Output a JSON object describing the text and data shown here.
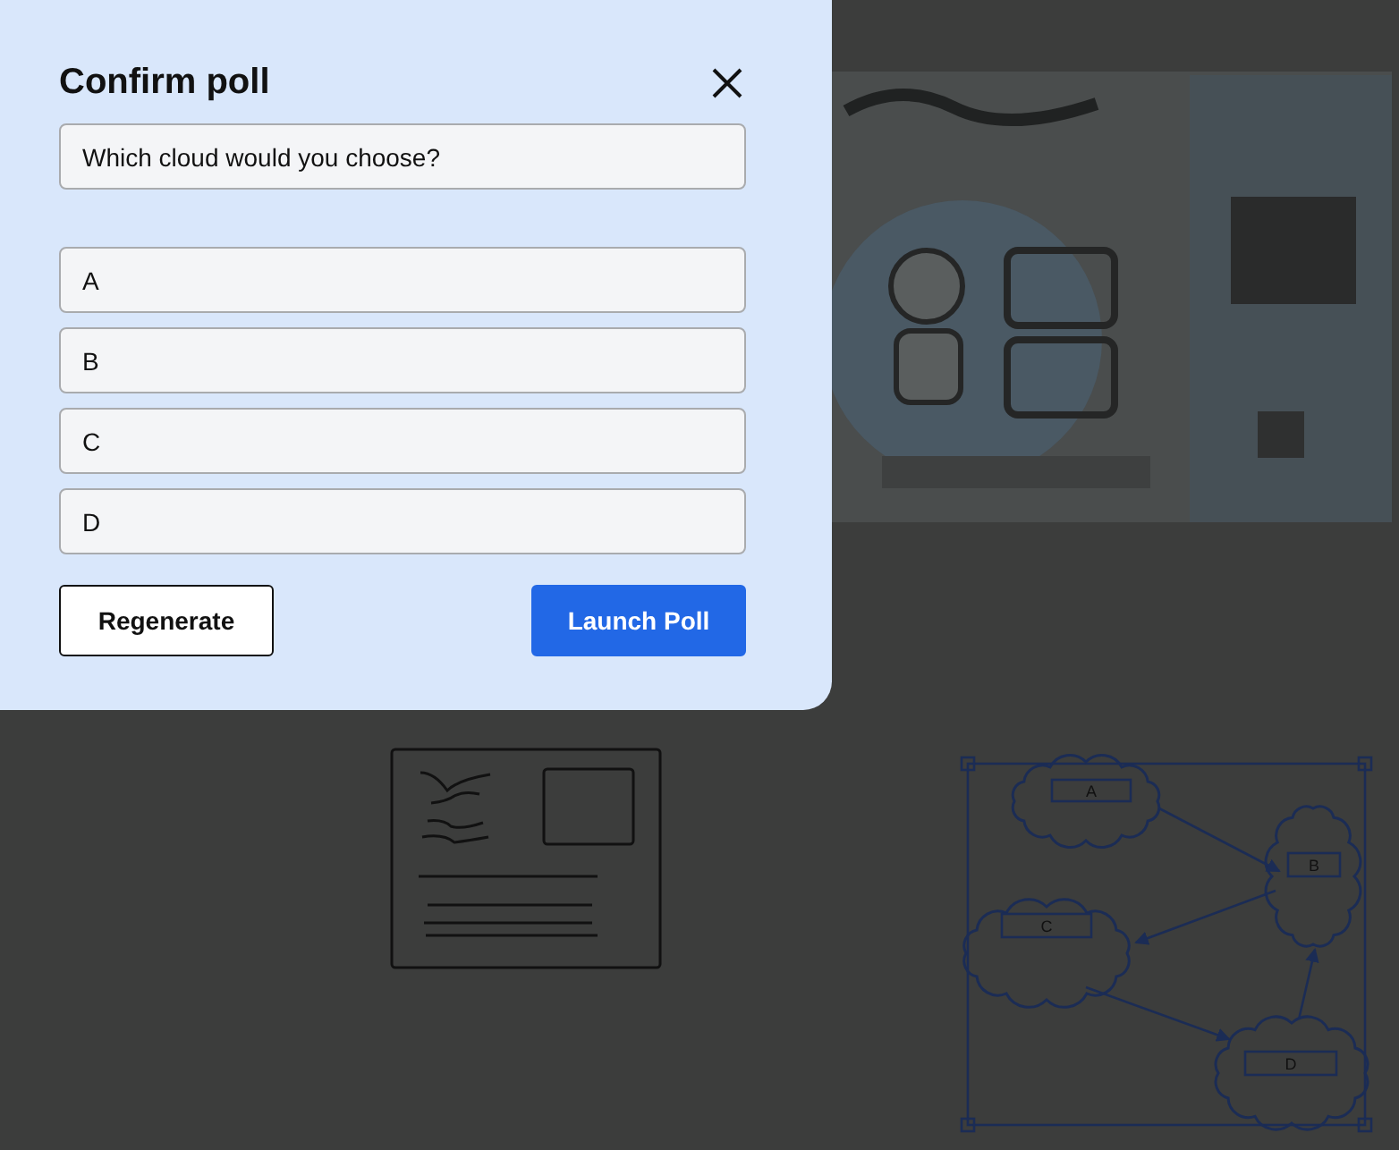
{
  "dialog": {
    "title": "Confirm poll",
    "question": "Which cloud would you choose?",
    "options": [
      "A",
      "B",
      "C",
      "D"
    ],
    "buttons": [
      {
        "label": "Regenerate",
        "kind": "secondary"
      },
      {
        "label": "Launch Poll",
        "kind": "primary"
      }
    ]
  },
  "canvas": {
    "diagram": {
      "selected": true,
      "nodes": [
        "A",
        "B",
        "C",
        "D"
      ]
    }
  }
}
